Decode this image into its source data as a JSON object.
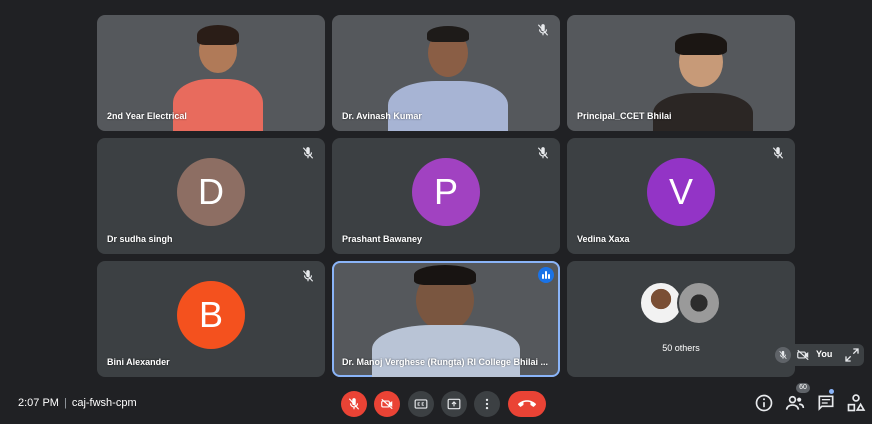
{
  "participants": [
    {
      "name": "2nd Year Electrical",
      "type": "video"
    },
    {
      "name": "Dr. Avinash Kumar",
      "type": "video",
      "muted": true
    },
    {
      "name": "Principal_CCET Bhilai",
      "type": "video"
    },
    {
      "name": "Dr sudha singh",
      "type": "avatar",
      "initial": "D",
      "color": "#8d6e63",
      "muted": true
    },
    {
      "name": "Prashant Bawaney",
      "type": "avatar",
      "initial": "P",
      "color": "#a142c1",
      "muted": true
    },
    {
      "name": "Vedina Xaxa",
      "type": "avatar",
      "initial": "V",
      "color": "#9334c6",
      "muted": true
    },
    {
      "name": "Bini Alexander",
      "type": "avatar",
      "initial": "B",
      "color": "#f4511e",
      "muted": true
    },
    {
      "name": "Dr. Manoj Verghese (Rungta) RI College Bhilai ...",
      "type": "video",
      "speaking": true
    }
  ],
  "others": {
    "label": "50 others"
  },
  "self_view": {
    "label": "You"
  },
  "meeting": {
    "time": "2:07 PM",
    "separator": "|",
    "code": "caj-fwsh-cpm"
  },
  "participant_count": "60",
  "controls": {
    "buttons": [
      "mic-off",
      "camera-off",
      "captions",
      "present",
      "more-options",
      "end-call"
    ],
    "right_icons": [
      "info",
      "people",
      "chat",
      "activities"
    ]
  },
  "colors": {
    "background": "#202124",
    "tile": "#3c4043",
    "danger": "#ea4335",
    "accent": "#1a73e8"
  }
}
